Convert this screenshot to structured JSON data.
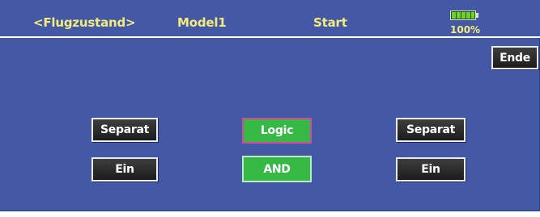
{
  "header": {
    "condition": "<Flugzustand>",
    "model": "Model1",
    "screen_title": "Start",
    "battery": {
      "level": 1.0,
      "percent_label": "100%",
      "icon": "battery-icon"
    }
  },
  "toolbar": {
    "end_label": "Ende"
  },
  "left_switch": {
    "mode_label": "Separat",
    "state_label": "Ein"
  },
  "center_logic": {
    "logic_label": "Logic",
    "operator_label": "AND"
  },
  "right_switch": {
    "mode_label": "Separat",
    "state_label": "Ein"
  },
  "colors": {
    "screen_background": "#4459a5",
    "header_text": "#f4ec7a",
    "button_dark": "#2b2b2b",
    "button_green": "#36b845",
    "selected_border": "#d64a9e"
  }
}
